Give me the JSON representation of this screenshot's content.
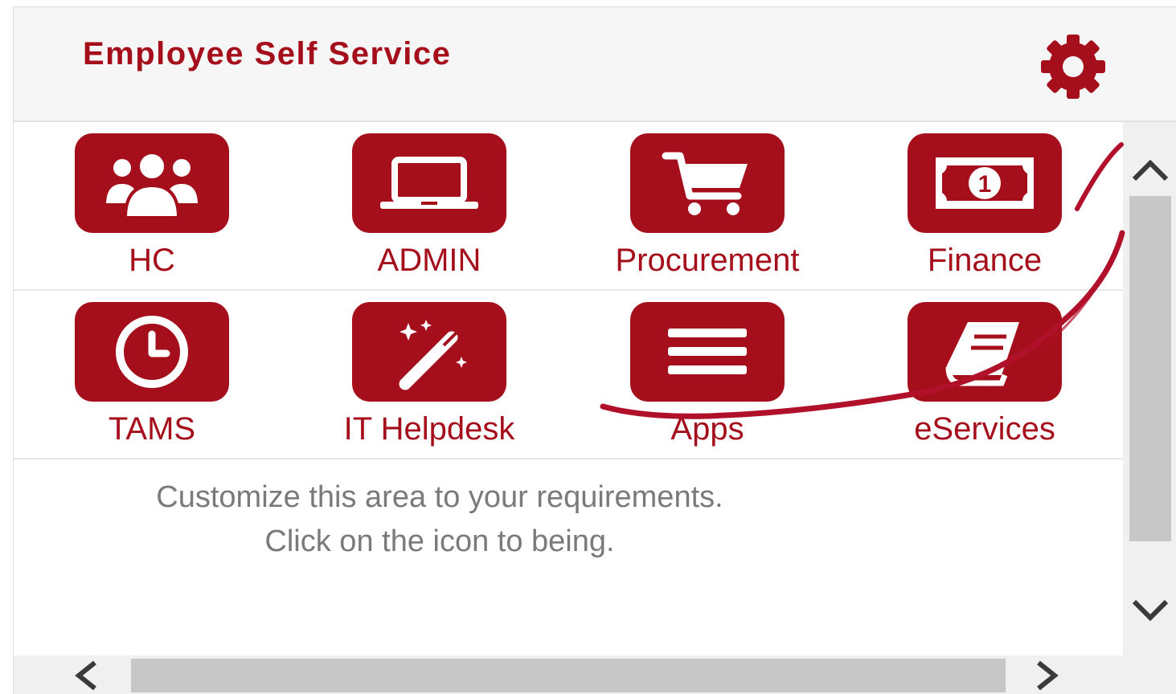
{
  "header": {
    "title": "Employee Self Service",
    "settings_icon": "gear-icon"
  },
  "tiles": [
    {
      "label": "HC",
      "icon": "users-icon"
    },
    {
      "label": "ADMIN",
      "icon": "laptop-icon"
    },
    {
      "label": "Procurement",
      "icon": "shopping-cart-icon"
    },
    {
      "label": "Finance",
      "icon": "money-bill-icon"
    },
    {
      "label": "TAMS",
      "icon": "clock-icon"
    },
    {
      "label": "IT Helpdesk",
      "icon": "magic-wand-icon"
    },
    {
      "label": "Apps",
      "icon": "bars-icon"
    },
    {
      "label": "eServices",
      "icon": "book-icon"
    }
  ],
  "hint": "Customize this area to your requirements. Click on the icon to being.",
  "colors": {
    "accent": "#a50f1b",
    "header_bg": "#f6f6f6",
    "hint_text": "#7a7a7a",
    "scrollbar_thumb": "#c7c7c7"
  }
}
